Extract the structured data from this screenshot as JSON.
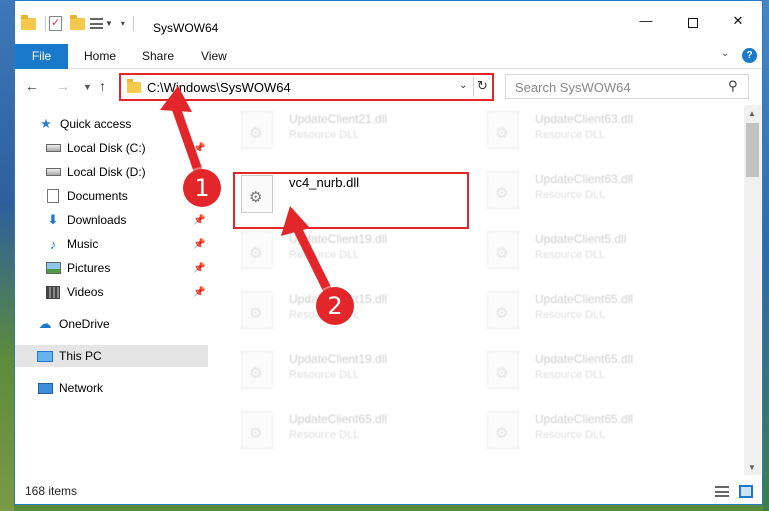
{
  "window": {
    "title": "SysWOW64",
    "controls": {
      "minimize": "—",
      "maximize": "",
      "close": "✕"
    }
  },
  "ribbon": {
    "tabs": [
      "File",
      "Home",
      "Share",
      "View"
    ],
    "help": "?"
  },
  "nav": {
    "address": "C:\\Windows\\SysWOW64",
    "search_placeholder": "Search SysWOW64"
  },
  "sidebar": {
    "items": [
      {
        "label": "Quick access",
        "icon": "star-icon",
        "pinned": false
      },
      {
        "label": "Local Disk (C:)",
        "icon": "drive-icon",
        "pinned": true
      },
      {
        "label": "Local Disk (D:)",
        "icon": "drive-icon",
        "pinned": false
      },
      {
        "label": "Documents",
        "icon": "documents-icon",
        "pinned": true
      },
      {
        "label": "Downloads",
        "icon": "downloads-icon",
        "pinned": true
      },
      {
        "label": "Music",
        "icon": "music-icon",
        "pinned": true
      },
      {
        "label": "Pictures",
        "icon": "pictures-icon",
        "pinned": true
      },
      {
        "label": "Videos",
        "icon": "videos-icon",
        "pinned": true
      },
      {
        "label": "OneDrive",
        "icon": "onedrive-icon"
      },
      {
        "label": "This PC",
        "icon": "this-pc-icon",
        "selected": true
      },
      {
        "label": "Network",
        "icon": "network-icon"
      }
    ]
  },
  "files": {
    "left": [
      {
        "name": "UpdateClient21.dll",
        "type": "Resource DLL"
      },
      {
        "name": "vc4_nurb.dll",
        "type": ""
      },
      {
        "name": "UpdateClient19.dll",
        "type": "Resource DLL"
      },
      {
        "name": "UpdateClient15.dll",
        "type": "Resource DLL"
      },
      {
        "name": "UpdateClient19.dll",
        "type": "Resource DLL"
      },
      {
        "name": "UpdateClient65.dll",
        "type": "Resource DLL"
      }
    ],
    "right": [
      {
        "name": "UpdateClient63.dll",
        "type": "Resource DLL"
      },
      {
        "name": "UpdateClient63.dll",
        "type": "Resource DLL"
      },
      {
        "name": "UpdateClient5.dll",
        "type": "Resource DLL"
      },
      {
        "name": "UpdateClient65.dll",
        "type": "Resource DLL"
      },
      {
        "name": "UpdateClient65.dll",
        "type": "Resource DLL"
      },
      {
        "name": "UpdateClient65.dll",
        "type": "Resource DLL"
      }
    ]
  },
  "status": {
    "item_count": "168 items"
  },
  "annotations": {
    "step1": "1",
    "step2": "2",
    "color": "#e3262a"
  }
}
